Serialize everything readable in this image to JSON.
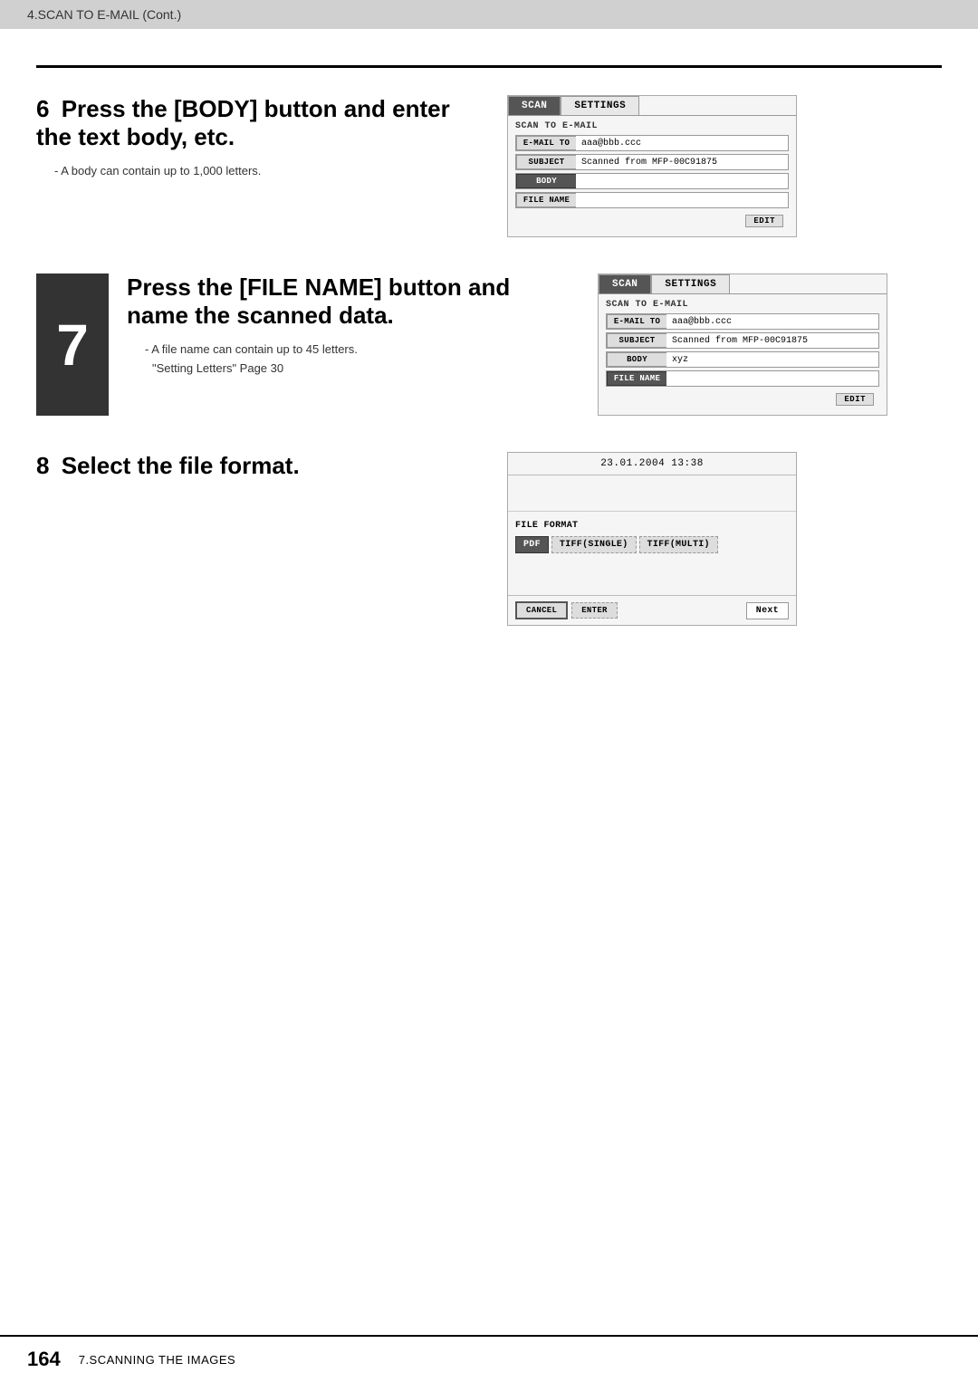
{
  "header": {
    "title": "4.SCAN TO E-MAIL (Cont.)"
  },
  "footer": {
    "page_number": "164",
    "section_label": "7.SCANNING THE IMAGES"
  },
  "step6": {
    "number": "6",
    "heading": "Press the [BODY] button and enter the text body, etc.",
    "bullet": "A body can contain up to 1,000 letters.",
    "screen": {
      "tab_scan": "SCAN",
      "tab_settings": "SETTINGS",
      "screen_label": "SCAN TO E-MAIL",
      "rows": [
        {
          "key": "E-MAIL TO",
          "value": "aaa@bbb.ccc",
          "active": false
        },
        {
          "key": "SUBJECT",
          "value": "Scanned from MFP-00C91875",
          "active": false
        },
        {
          "key": "BODY",
          "value": "",
          "active": true
        },
        {
          "key": "FILE NAME",
          "value": "",
          "active": false
        }
      ],
      "edit_label": "EDIT"
    }
  },
  "step7": {
    "number": "7",
    "heading": "Press the [FILE NAME] button and name the scanned data.",
    "bullet1": "A file name can contain up to 45 letters.",
    "bullet2": "\"Setting Letters\"  Page 30",
    "screen": {
      "tab_scan": "SCAN",
      "tab_settings": "SETTINGS",
      "screen_label": "SCAN TO E-MAIL",
      "rows": [
        {
          "key": "E-MAIL TO",
          "value": "aaa@bbb.ccc",
          "active": false
        },
        {
          "key": "SUBJECT",
          "value": "Scanned from MFP-00C91875",
          "active": false
        },
        {
          "key": "BODY",
          "value": "xyz",
          "active": false
        },
        {
          "key": "FILE NAME",
          "value": "",
          "active": true
        }
      ],
      "edit_label": "EDIT"
    }
  },
  "step8": {
    "number": "8",
    "heading": "Select the file format.",
    "screen": {
      "date_time": "23.01.2004 13:38",
      "format_label": "FILE FORMAT",
      "buttons": [
        {
          "label": "PDF",
          "active": true
        },
        {
          "label": "TIFF(SINGLE)",
          "active": false
        },
        {
          "label": "TIFF(MULTI)",
          "active": false
        }
      ],
      "cancel_label": "CANCEL",
      "enter_label": "ENTER",
      "next_label": "Next"
    }
  }
}
